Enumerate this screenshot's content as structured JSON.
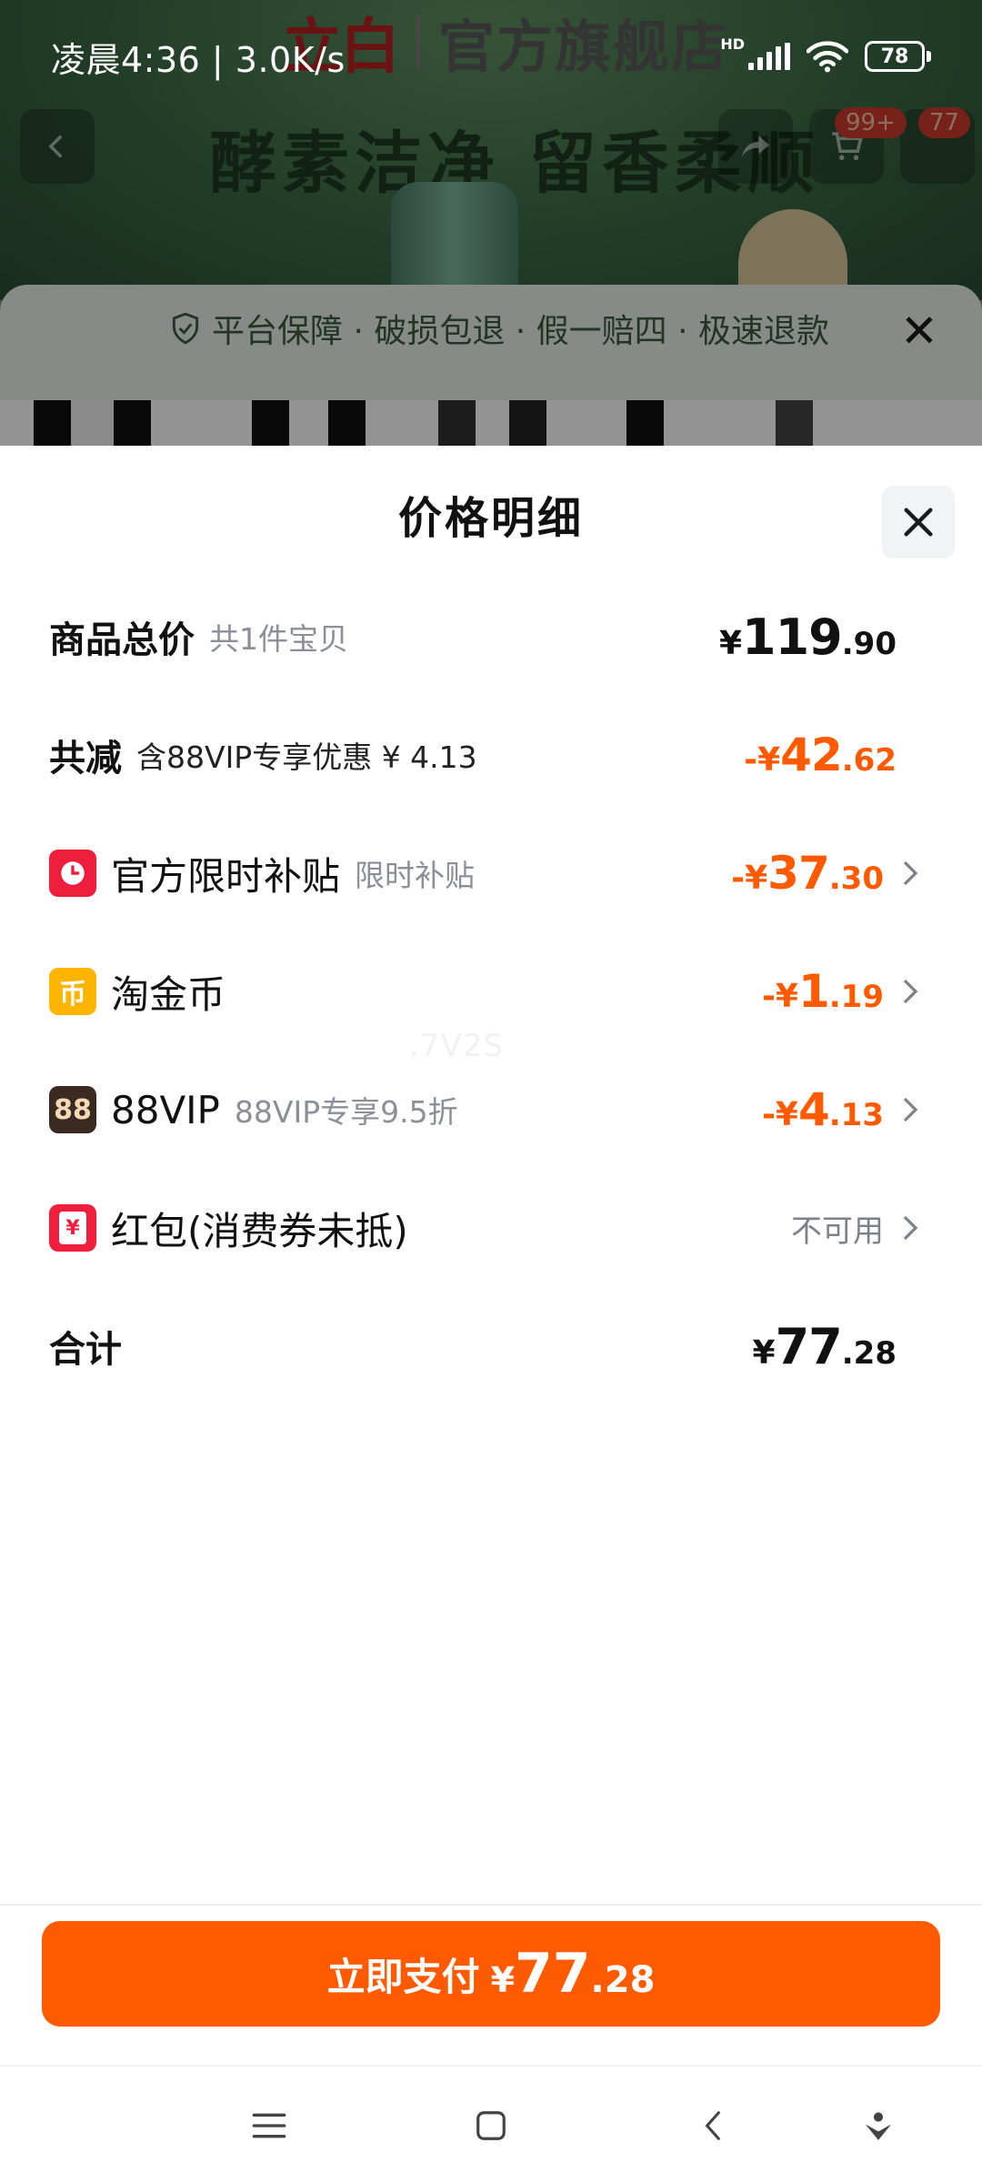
{
  "status_bar": {
    "time": "凌晨4:36 | 3.0K/s",
    "network": "HD",
    "battery": "78"
  },
  "background_page": {
    "brand_logo": "立白",
    "store_name": "官方旗舰店",
    "slogan": "酵素洁净 留香柔顺",
    "cart_badge": "99+",
    "badge_2": "77",
    "guarantee_text": "平台保障 · 破损包退 · 假一赔四 · 极速退款"
  },
  "sheet": {
    "title": "价格明细",
    "rows": [
      {
        "label": "商品总价",
        "sub": "共1件宝贝",
        "price": {
          "symbol": "¥",
          "integer": "119",
          "decimal": ".90"
        }
      },
      {
        "label": "共减",
        "sub": "含88VIP专享优惠 ¥ 4.13",
        "price": {
          "sign": "-",
          "symbol": "¥",
          "integer": "42",
          "decimal": ".62"
        }
      },
      {
        "icon": "clock-icon",
        "label": "官方限时补贴",
        "sub": "限时补贴",
        "price": {
          "sign": "-",
          "symbol": "¥",
          "integer": "37",
          "decimal": ".30"
        }
      },
      {
        "icon": "coin-icon",
        "icon_text": "币",
        "label": "淘金币",
        "price": {
          "sign": "-",
          "symbol": "¥",
          "integer": "1",
          "decimal": ".19"
        }
      },
      {
        "icon": "88vip-icon",
        "icon_text": "88",
        "label": "88VIP",
        "sub": "88VIP专享9.5折",
        "price": {
          "sign": "-",
          "symbol": "¥",
          "integer": "4",
          "decimal": ".13"
        }
      },
      {
        "icon": "red-packet-icon",
        "icon_text": "¥",
        "label": "红包(消费券未抵)",
        "status": "不可用"
      },
      {
        "label": "合计",
        "price": {
          "symbol": "¥",
          "integer": "77",
          "decimal": ".28"
        }
      }
    ],
    "watermark": ".7V2S"
  },
  "pay_button": {
    "label": "立即支付",
    "symbol": "¥",
    "integer": "77",
    "decimal": ".28"
  },
  "colors": {
    "accent": "#ff5a00",
    "red_icon": "#ee1e3c",
    "coin_icon": "#ffb400",
    "vip_icon": "#3b2a22"
  }
}
